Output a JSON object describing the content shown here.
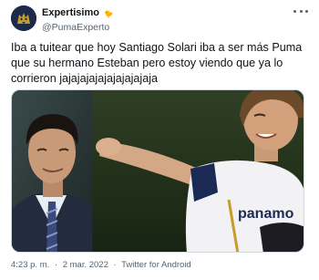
{
  "author": {
    "display_name": "Expertisimo",
    "verified_glyph": "🐤",
    "handle": "@PumaExperto"
  },
  "more_icon": "more-horizontal-icon",
  "tweet_text": "Iba a tuitear que hoy Santiago Solari iba a ser más Puma que su hermano Esteban pero estoy viendo que ya lo corrieron jajajajajajajajajajaja",
  "media": {
    "photos": [
      "man-in-suit-photo",
      "pumas-player-photo"
    ],
    "jersey_text": "panamo"
  },
  "meta": {
    "time": "4:23 p. m.",
    "date": "2 mar. 2022",
    "separator": "·",
    "source": "Twitter for Android"
  },
  "colors": {
    "text": "#0f1419",
    "secondary": "#536471",
    "border": "#cfd9de",
    "jersey_navy": "#1a2a55",
    "jersey_gold": "#c89b2a"
  }
}
